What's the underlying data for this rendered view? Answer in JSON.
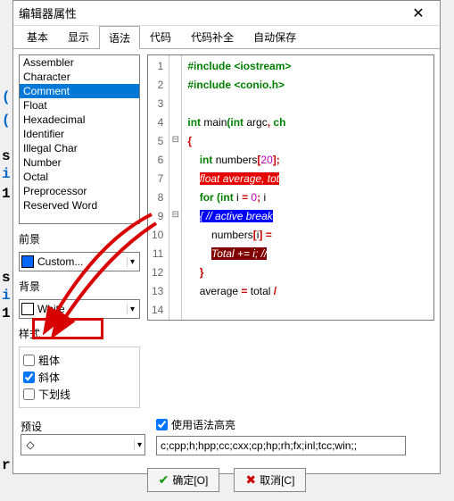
{
  "window": {
    "title": "编辑器属性"
  },
  "tabs": [
    "基本",
    "显示",
    "语法",
    "代码",
    "代码补全",
    "自动保存"
  ],
  "activeTab": 2,
  "syntaxList": [
    "Assembler",
    "Character",
    "Comment",
    "Float",
    "Hexadecimal",
    "Identifier",
    "Illegal Char",
    "Number",
    "Octal",
    "Preprocessor",
    "Reserved Word"
  ],
  "syntaxSelected": "Comment",
  "labels": {
    "foreground": "前景",
    "background": "背景",
    "style": "样式",
    "preset": "预设",
    "useHighlight": "使用语法高亮"
  },
  "foreground": {
    "value": "Custom...",
    "color": "#0066ff"
  },
  "background": {
    "value": "White",
    "color": "#ffffff"
  },
  "styles": {
    "bold": {
      "label": "粗体",
      "checked": false
    },
    "italic": {
      "label": "斜体",
      "checked": true
    },
    "underline": {
      "label": "下划线",
      "checked": false
    }
  },
  "useHighlight": true,
  "extensions": "c;cpp;h;hpp;cc;cxx;cp;hp;rh;fx;inl;tcc;win;;",
  "buttons": {
    "ok": "确定[O]",
    "cancel": "取消[C]"
  },
  "code": {
    "lines": [
      {
        "n": 1,
        "html": "<span class='kw'>#include &lt;iostream&gt;</span>"
      },
      {
        "n": 2,
        "html": "<span class='kw'>#include &lt;conio.h&gt;</span>"
      },
      {
        "n": 3,
        "html": ""
      },
      {
        "n": 4,
        "html": "<span class='kw'>int</span> main<span class='paren'>(</span><span class='kw'>int</span> argc<span class='op'>,</span> <span class='kw'>ch</span>"
      },
      {
        "n": 5,
        "fold": "⊟",
        "html": "<span class='op'>{</span>"
      },
      {
        "n": 6,
        "html": "    <span class='kw'>int</span> numbers<span class='op'>[</span><span class='num'>20</span><span class='op'>];</span>"
      },
      {
        "n": 7,
        "html": "    <span class='str-red'>float average, tot</span>"
      },
      {
        "n": 8,
        "html": "    <span class='kw'>for</span> <span class='paren'>(</span><span class='kw'>int</span> i <span class='op'>=</span> <span class='num'>0</span><span class='op'>;</span> i"
      },
      {
        "n": 9,
        "fold": "⊟",
        "html": "    <span class='str-blue'>{ // active break</span>"
      },
      {
        "n": 10,
        "html": "        numbers<span class='op'>[</span>i<span class='op'>]</span> <span class='op'>=</span> "
      },
      {
        "n": 11,
        "html": "        <span class='str-dark'>Total += i; //</span>"
      },
      {
        "n": 12,
        "html": "    <span class='op'>}</span>"
      },
      {
        "n": 13,
        "html": "    average <span class='op'>=</span> total <span class='op'>/</span>"
      },
      {
        "n": 14,
        "html": ""
      }
    ]
  }
}
